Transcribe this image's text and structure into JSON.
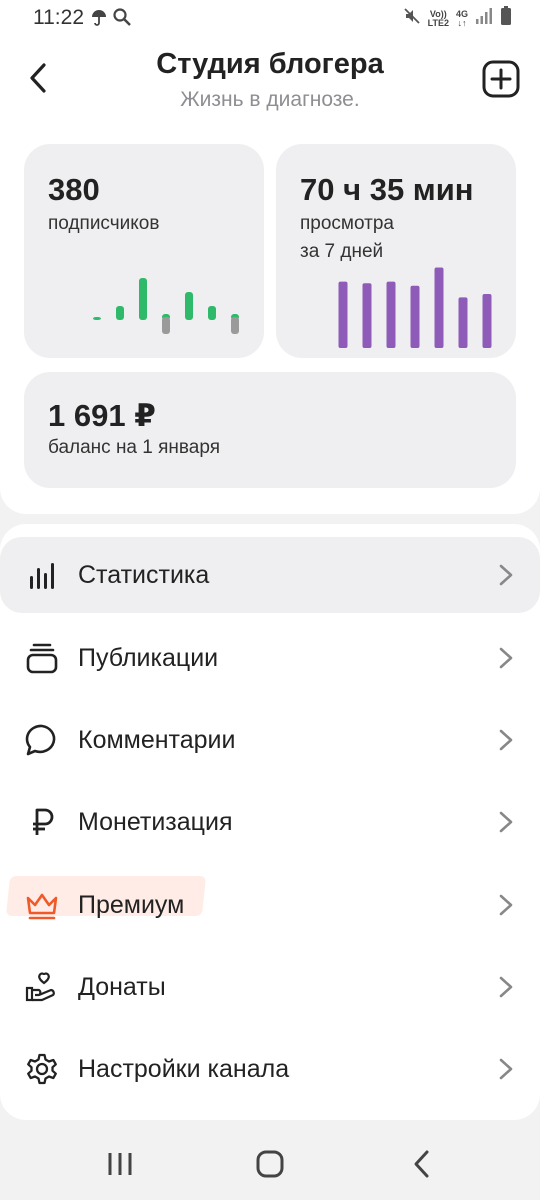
{
  "status_bar": {
    "time": "11:22",
    "net_top": "Vo))",
    "net_bottom": "LTE2",
    "gen_top": "4G",
    "gen_bottom": "↓↑"
  },
  "header": {
    "title": "Студия блогера",
    "subtitle": "Жизнь в диагнозе."
  },
  "stats": {
    "subscribers": {
      "value": "380",
      "label": "подписчиков"
    },
    "views": {
      "value": "70 ч 35 мин",
      "label_line1": "просмотра",
      "label_line2": "за 7 дней"
    },
    "balance": {
      "value": "1 691 ₽",
      "label": "баланс на 1 января"
    }
  },
  "subscribers_trend": {
    "type": "bar",
    "values": [
      0,
      1,
      3,
      -1,
      2,
      1,
      -1
    ],
    "color_positive": "#2fb96a",
    "color_negative": "#9a9a9a"
  },
  "views_trend": {
    "type": "bar",
    "values": [
      8,
      7.8,
      8,
      7.5,
      9.7,
      6.1,
      6.5
    ],
    "color": "#8e5cb8"
  },
  "menu": {
    "items": [
      {
        "label": "Статистика",
        "icon": "bar-chart-icon"
      },
      {
        "label": "Публикации",
        "icon": "stack-icon"
      },
      {
        "label": "Комментарии",
        "icon": "comment-icon"
      },
      {
        "label": "Монетизация",
        "icon": "ruble-icon"
      },
      {
        "label": "Премиум",
        "icon": "crown-icon"
      },
      {
        "label": "Донаты",
        "icon": "donate-heart-hand-icon"
      },
      {
        "label": "Настройки канала",
        "icon": "gear-icon"
      }
    ]
  },
  "colors": {
    "accent_premium": "#f05a28",
    "card_bg": "#efeff1"
  }
}
